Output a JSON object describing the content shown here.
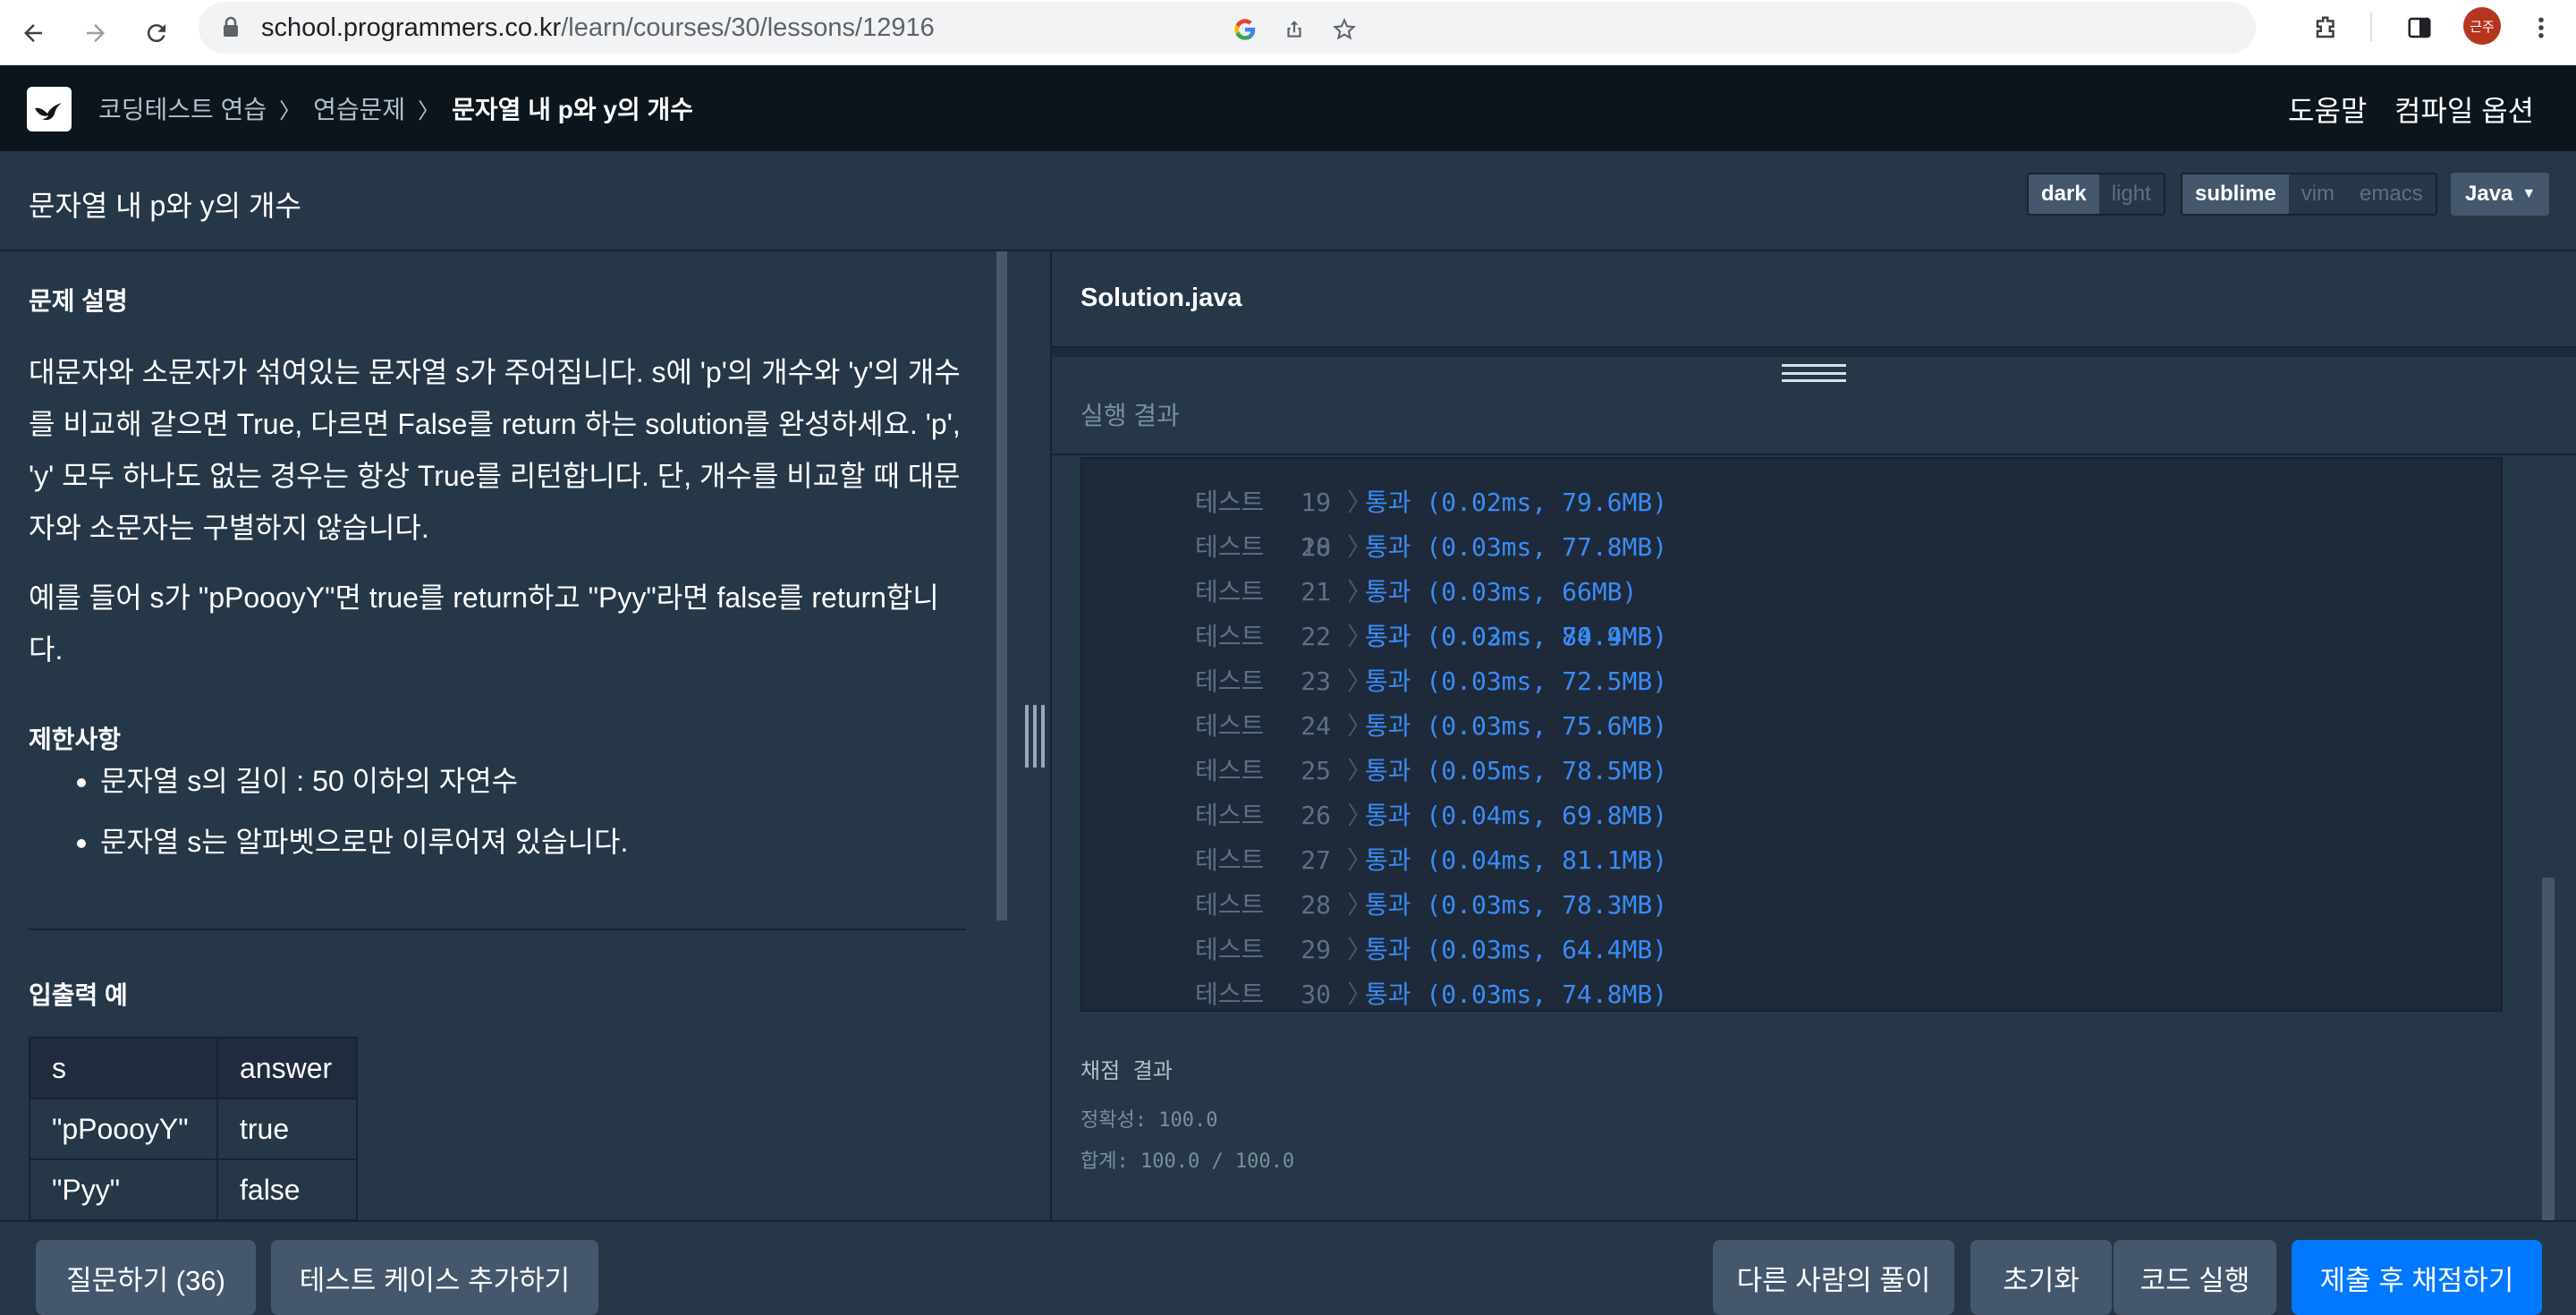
{
  "browser": {
    "url_domain": "school.programmers.co.kr",
    "url_path": "/learn/courses/30/lessons/12916",
    "avatar_text": "근주"
  },
  "header": {
    "breadcrumb_1": "코딩테스트 연습",
    "breadcrumb_2": "연습문제",
    "breadcrumb_3": "문자열 내 p와 y의 개수",
    "help": "도움말",
    "compile_options": "컴파일 옵션"
  },
  "toolbar": {
    "lesson_title": "문자열 내 p와 y의 개수",
    "theme_dark": "dark",
    "theme_light": "light",
    "keymap_sublime": "sublime",
    "keymap_vim": "vim",
    "keymap_emacs": "emacs",
    "language": "Java"
  },
  "problem": {
    "desc_title": "문제 설명",
    "desc_para1": "대문자와 소문자가 섞여있는 문자열 s가 주어집니다. s에 'p'의 개수와 'y'의 개수를 비교해 같으면 True, 다르면 False를 return 하는 solution를 완성하세요. 'p', 'y' 모두 하나도 없는 경우는 항상 True를 리턴합니다. 단, 개수를 비교할 때 대문자와 소문자는 구별하지 않습니다.",
    "desc_para2": "예를 들어 s가 \"pPoooyY\"면 true를 return하고 \"Pyy\"라면 false를 return합니다.",
    "constraints_title": "제한사항",
    "constraints": [
      "문자열 s의 길이 : 50 이하의 자연수",
      "문자열 s는 알파벳으로만 이루어져 있습니다."
    ],
    "io_title": "입출력 예",
    "io_header": [
      "s",
      "answer"
    ],
    "io_rows": [
      [
        "\"pPoooyY\"",
        "true"
      ],
      [
        "\"Pyy\"",
        "false"
      ]
    ]
  },
  "editor": {
    "file_name": "Solution.java",
    "result_title": "실행 결과"
  },
  "results": {
    "label": "테스트",
    "pass_text": "통과",
    "partial_row": {
      "num": "18",
      "detail": "(0.02ms, 80.4MB)"
    },
    "rows": [
      {
        "num": "19",
        "detail": "(0.02ms, 79.6MB)"
      },
      {
        "num": "20",
        "detail": "(0.03ms, 77.8MB)"
      },
      {
        "num": "21",
        "detail": "(0.03ms, 66MB)"
      },
      {
        "num": "22",
        "detail": "(0.03ms, 74.9MB)"
      },
      {
        "num": "23",
        "detail": "(0.03ms, 72.5MB)"
      },
      {
        "num": "24",
        "detail": "(0.03ms, 75.6MB)"
      },
      {
        "num": "25",
        "detail": "(0.05ms, 78.5MB)"
      },
      {
        "num": "26",
        "detail": "(0.04ms, 69.8MB)"
      },
      {
        "num": "27",
        "detail": "(0.04ms, 81.1MB)"
      },
      {
        "num": "28",
        "detail": "(0.03ms, 78.3MB)"
      },
      {
        "num": "29",
        "detail": "(0.03ms, 64.4MB)"
      },
      {
        "num": "30",
        "detail": "(0.03ms, 74.8MB)"
      }
    ],
    "score_title": "채점 결과",
    "accuracy": "정확성: 100.0",
    "total": "합계: 100.0 / 100.0"
  },
  "footer": {
    "ask": "질문하기 (36)",
    "add_testcase": "테스트 케이스 추가하기",
    "others_solutions": "다른 사람의 풀이",
    "reset": "초기화",
    "run": "코드 실행",
    "submit": "제출 후 채점하기"
  },
  "colors": {
    "background": "#263747",
    "header": "#0c151c",
    "pass": "#3a8cf6",
    "primary_button": "#0078ff"
  }
}
